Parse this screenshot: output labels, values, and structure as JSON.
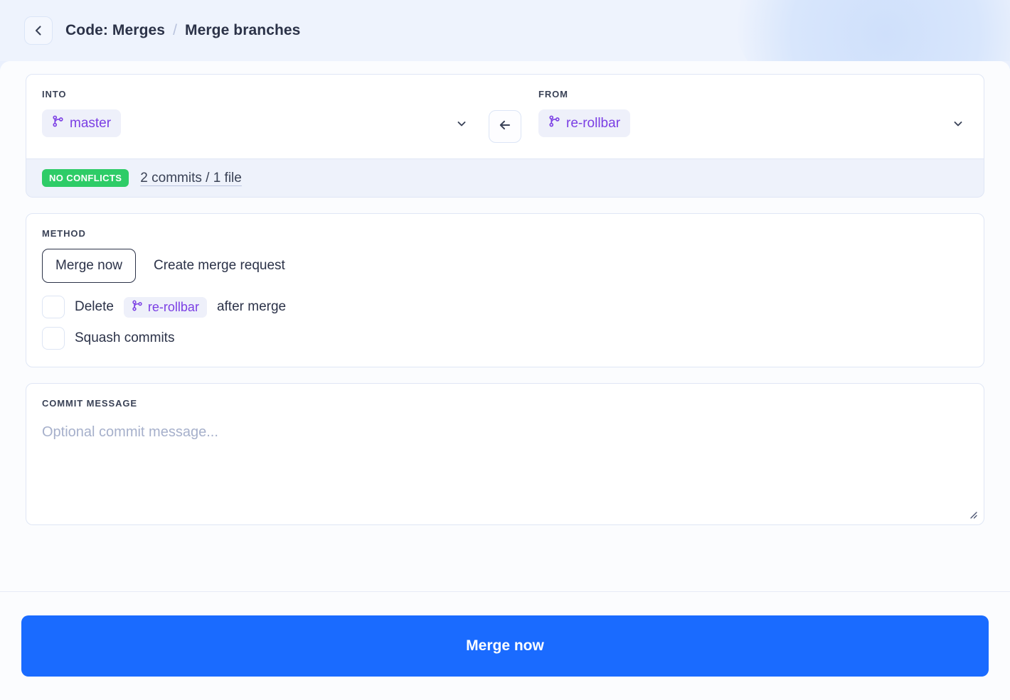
{
  "header": {
    "back_icon": "chevron-left-icon",
    "breadcrumb_root": "Code: Merges",
    "breadcrumb_separator": "/",
    "breadcrumb_current": "Merge branches"
  },
  "branches": {
    "into": {
      "label": "INTO",
      "branch_icon": "git-branch-icon",
      "branch_name": "master",
      "dropdown_icon": "chevron-down-icon"
    },
    "from": {
      "label": "FROM",
      "branch_icon": "git-branch-icon",
      "branch_name": "re-rollbar",
      "dropdown_icon": "chevron-down-icon"
    },
    "swap_icon": "arrow-left-icon"
  },
  "status": {
    "badge": "NO CONFLICTS",
    "badge_color": "#2ecc67",
    "summary": "2 commits / 1 file"
  },
  "method": {
    "label": "METHOD",
    "options": [
      {
        "label": "Merge now",
        "selected": true
      },
      {
        "label": "Create merge request",
        "selected": false
      }
    ],
    "delete_prefix": "Delete",
    "delete_branch": "re-rollbar",
    "delete_suffix": "after merge",
    "delete_checked": false,
    "squash_label": "Squash commits",
    "squash_checked": false
  },
  "commit_message": {
    "label": "COMMIT MESSAGE",
    "value": "",
    "placeholder": "Optional commit message..."
  },
  "footer": {
    "primary_label": "Merge now",
    "primary_color": "#1a6bff"
  }
}
